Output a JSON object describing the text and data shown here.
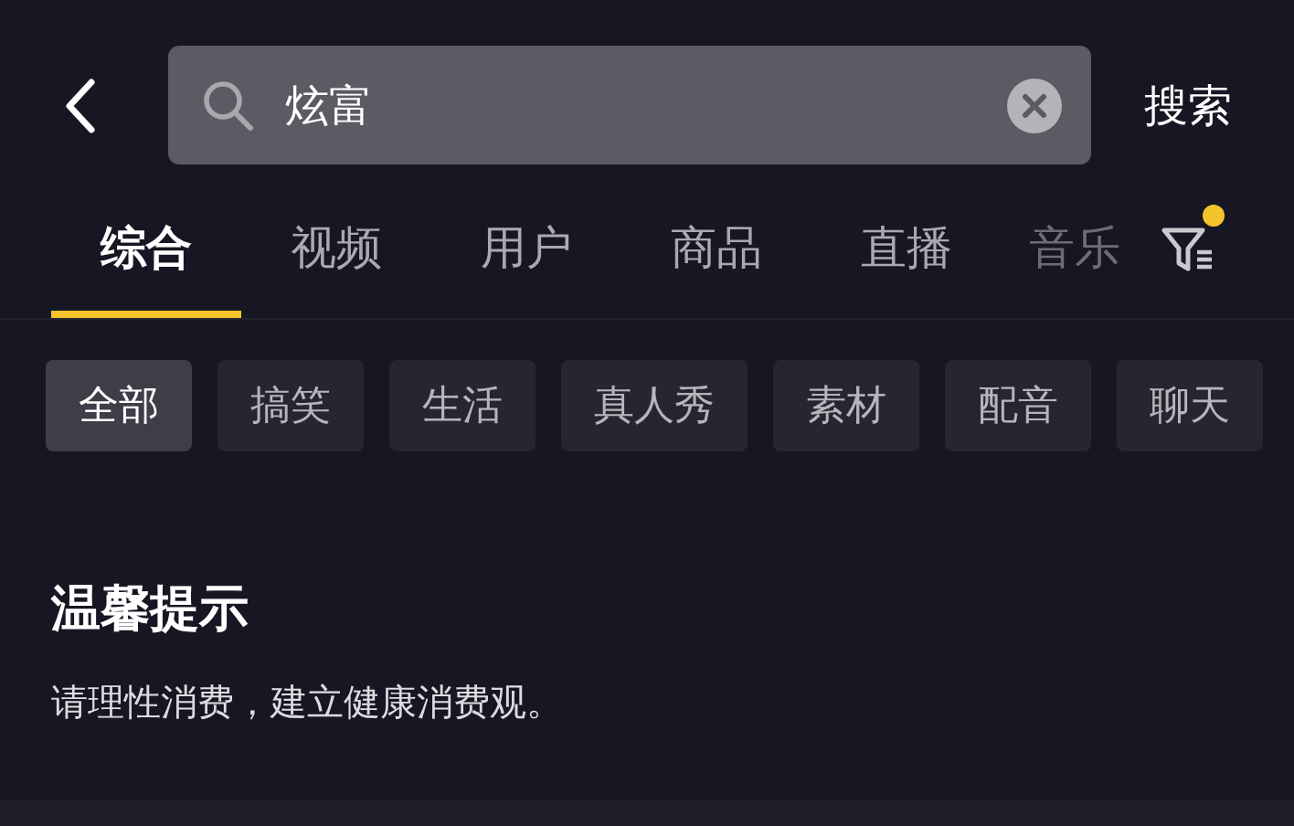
{
  "search": {
    "value": "炫富",
    "submit": "搜索"
  },
  "tabs": [
    {
      "label": "综合",
      "selected": true
    },
    {
      "label": "视频",
      "selected": false
    },
    {
      "label": "用户",
      "selected": false
    },
    {
      "label": "商品",
      "selected": false
    },
    {
      "label": "直播",
      "selected": false
    },
    {
      "label": "音乐",
      "selected": false
    }
  ],
  "filter": {
    "badge": true
  },
  "chips": [
    {
      "label": "全部",
      "selected": true
    },
    {
      "label": "搞笑",
      "selected": false
    },
    {
      "label": "生活",
      "selected": false
    },
    {
      "label": "真人秀",
      "selected": false
    },
    {
      "label": "素材",
      "selected": false
    },
    {
      "label": "配音",
      "selected": false
    },
    {
      "label": "聊天",
      "selected": false
    }
  ],
  "notice": {
    "title": "温馨提示",
    "text": "请理性消费，建立健康消费观。"
  }
}
